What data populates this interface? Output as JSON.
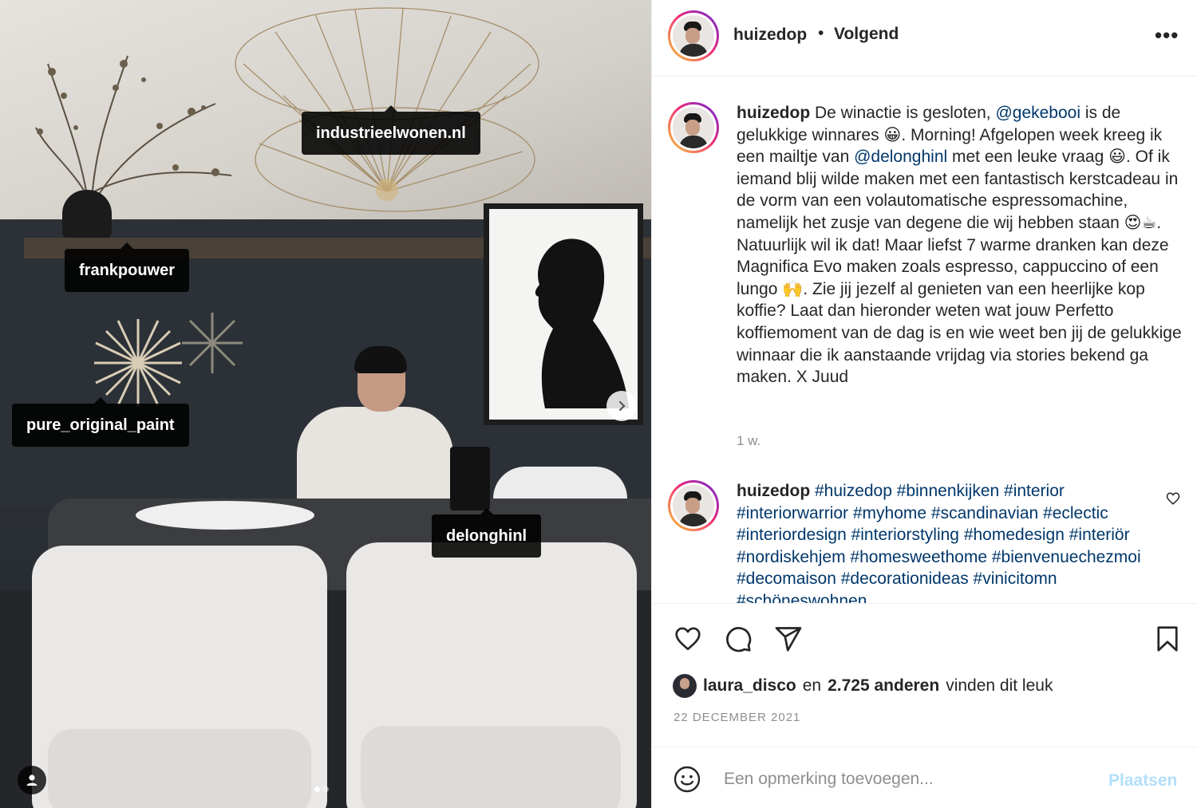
{
  "post": {
    "username": "huizedop",
    "follow_status": "Volgend",
    "separator": "•",
    "more_label": "•••"
  },
  "photo_tags": [
    {
      "label": "industrieelwonen.nl"
    },
    {
      "label": "frankpouwer"
    },
    {
      "label": "pure_original_paint"
    },
    {
      "label": "delonghinl"
    }
  ],
  "carousel": {
    "slide_count": 2,
    "active_index": 0
  },
  "caption": {
    "username": "huizedop",
    "seg1": " De winactie is gesloten, ",
    "mention1": "@gekebooi",
    "seg2": " is de gelukkige winnares 😀. Morning! Afgelopen week kreeg ik een mailtje van ",
    "mention2": "@delonghinl",
    "seg3": " met een leuke vraag 😃. Of ik iemand blij wilde maken met een fantastisch kerstcadeau in de vorm van een volautomatische espressomachine, namelijk het zusje van degene die wij hebben staan 😍☕. Natuurlijk wil ik dat! Maar liefst 7 warme dranken kan deze Magnifica Evo maken zoals espresso, cappuccino of een lungo 🙌. Zie jij jezelf al genieten van een heerlijke kop koffie? Laat dan hieronder weten wat jouw Perfetto koffiemoment van de dag is en wie weet ben jij de gelukkige winnaar die ik aanstaande vrijdag via stories bekend ga maken. X Juud",
    "time": "1 w."
  },
  "hashtag_comment": {
    "username": "huizedop",
    "text": "#huizedop #binnenkijken #interior #interiorwarrior #myhome #scandinavian  #eclectic #interiordesign #interiorstyling #homedesign #interiör #nordiskehjem #homesweethome #bienvenuechezmoi #decomaison #decorationideas #vinicitomn #schöneswohnen"
  },
  "likes": {
    "liker": "laura_disco",
    "middle": "en",
    "count": "2.725 anderen",
    "suffix": "vinden dit leuk"
  },
  "date": "22 DECEMBER 2021",
  "add_comment": {
    "placeholder": "Een opmerking toevoegen...",
    "post_label": "Plaatsen"
  },
  "colors": {
    "link": "#00376b",
    "post_button_disabled": "#b2dffc",
    "muted": "#8e8e8e"
  }
}
